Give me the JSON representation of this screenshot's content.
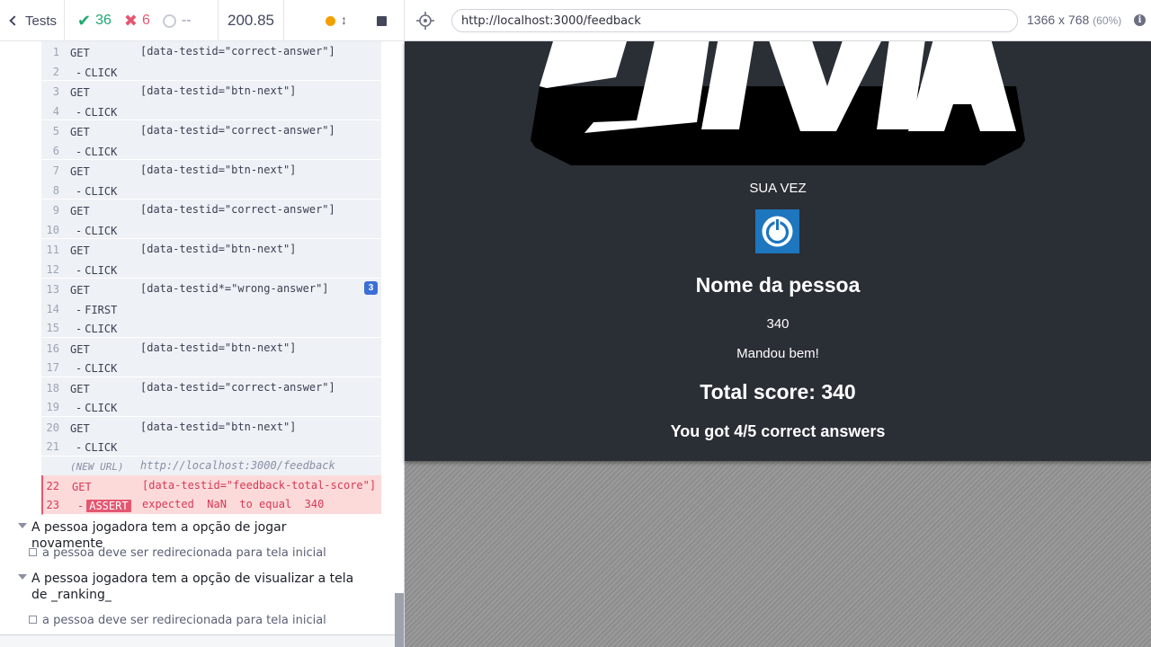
{
  "topbar": {
    "tests_label": "Tests",
    "passed": "36",
    "failed": "6",
    "pending": "--",
    "duration": "200.85",
    "url": "http://localhost:3000/feedback",
    "viewport": "1366 x 768",
    "scale": "(60%)",
    "icons": [
      "chevron-left-icon",
      "check-icon",
      "x-icon",
      "pending-ring-icon",
      "running-dot-icon",
      "scroll-arrows-icon",
      "stop-icon",
      "selector-crosshair-icon",
      "info-icon"
    ]
  },
  "command_log": {
    "rows": [
      {
        "lines": [
          {
            "num": "1",
            "name": "GET",
            "msg": "[data-testid=\"correct-answer\"]"
          },
          {
            "num": "2",
            "name": "CLICK",
            "child": true
          }
        ]
      },
      {
        "lines": [
          {
            "num": "3",
            "name": "GET",
            "msg": "[data-testid=\"btn-next\"]"
          },
          {
            "num": "4",
            "name": "CLICK",
            "child": true
          }
        ]
      },
      {
        "lines": [
          {
            "num": "5",
            "name": "GET",
            "msg": "[data-testid=\"correct-answer\"]"
          },
          {
            "num": "6",
            "name": "CLICK",
            "child": true
          }
        ]
      },
      {
        "lines": [
          {
            "num": "7",
            "name": "GET",
            "msg": "[data-testid=\"btn-next\"]"
          },
          {
            "num": "8",
            "name": "CLICK",
            "child": true
          }
        ]
      },
      {
        "lines": [
          {
            "num": "9",
            "name": "GET",
            "msg": "[data-testid=\"correct-answer\"]"
          },
          {
            "num": "10",
            "name": "CLICK",
            "child": true
          }
        ]
      },
      {
        "lines": [
          {
            "num": "11",
            "name": "GET",
            "msg": "[data-testid=\"btn-next\"]"
          },
          {
            "num": "12",
            "name": "CLICK",
            "child": true
          }
        ]
      },
      {
        "badge": "3",
        "lines": [
          {
            "num": "13",
            "name": "GET",
            "msg": "[data-testid*=\"wrong-answer\"]"
          },
          {
            "num": "14",
            "name": "FIRST",
            "child": true
          },
          {
            "num": "15",
            "name": "CLICK",
            "child": true
          }
        ]
      },
      {
        "lines": [
          {
            "num": "16",
            "name": "GET",
            "msg": "[data-testid=\"btn-next\"]"
          },
          {
            "num": "17",
            "name": "CLICK",
            "child": true
          }
        ]
      },
      {
        "lines": [
          {
            "num": "18",
            "name": "GET",
            "msg": "[data-testid=\"correct-answer\"]"
          },
          {
            "num": "19",
            "name": "CLICK",
            "child": true
          }
        ]
      },
      {
        "lines": [
          {
            "num": "20",
            "name": "GET",
            "msg": "[data-testid=\"btn-next\"]"
          },
          {
            "num": "21",
            "name": "CLICK",
            "child": true
          }
        ]
      }
    ],
    "new_url": {
      "label": "(NEW URL)",
      "url": "http://localhost:3000/feedback"
    },
    "failed": {
      "get_num": "22",
      "get_name": "GET",
      "get_msg": "[data-testid=\"feedback-total-score\"]",
      "assert_num": "23",
      "assert_name": "ASSERT",
      "assert_msg": "expected  NaN  to equal  340"
    }
  },
  "suites": [
    {
      "title": "A pessoa jogadora tem a opção de jogar novamente",
      "tests": [
        "a pessoa deve ser redirecionada para tela inicial"
      ]
    },
    {
      "title": "A pessoa jogadora tem a opção de visualizar a tela de _ranking_",
      "tests": [
        "a pessoa deve ser redirecionada para tela inicial"
      ]
    }
  ],
  "app": {
    "logo_icon": "trivia-logo",
    "player_label": "SUA VEZ",
    "player_name": "Nome da pessoa",
    "header_score": "340",
    "feedback_text": "Mandou bem!",
    "total_score": "Total score: 340",
    "correct_answers": "You got 4/5 correct answers"
  },
  "colors": {
    "pass": "#1fa971",
    "fail": "#e45770",
    "app_bg": "#2a2e35",
    "avatar": "#1d76be",
    "badge": "#3c6fd6"
  }
}
